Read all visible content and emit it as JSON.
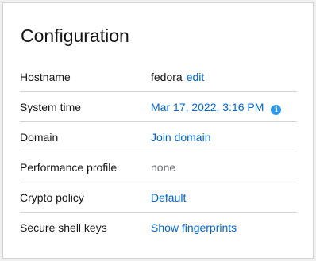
{
  "card": {
    "title": "Configuration"
  },
  "rows": {
    "hostname": {
      "label": "Hostname",
      "value": "fedora",
      "action": "edit"
    },
    "system_time": {
      "label": "System time",
      "value": "Mar 17, 2022, 3:16 PM",
      "icon": "info-icon"
    },
    "domain": {
      "label": "Domain",
      "value": "Join domain"
    },
    "performance_profile": {
      "label": "Performance profile",
      "value": "none"
    },
    "crypto_policy": {
      "label": "Crypto policy",
      "value": "Default"
    },
    "ssh_keys": {
      "label": "Secure shell keys",
      "value": "Show fingerprints"
    }
  },
  "colors": {
    "link": "#0066cc",
    "info_icon": "#2b9af3",
    "muted_text": "#6a6e73",
    "divider": "#d2d2d2"
  }
}
